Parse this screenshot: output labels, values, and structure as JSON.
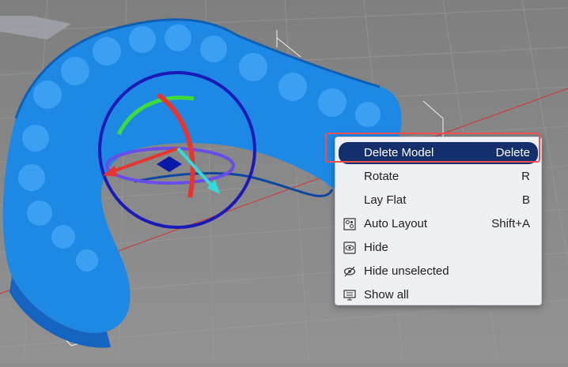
{
  "context_menu": {
    "items": [
      {
        "label": "Delete Model",
        "shortcut": "Delete",
        "icon": "",
        "highlighted": true
      },
      {
        "label": "Rotate",
        "shortcut": "R",
        "icon": ""
      },
      {
        "label": "Lay Flat",
        "shortcut": "B",
        "icon": ""
      },
      {
        "label": "Auto Layout",
        "shortcut": "Shift+A",
        "icon": "auto-layout-icon"
      },
      {
        "label": "Hide",
        "shortcut": "",
        "icon": "hide-icon"
      },
      {
        "label": "Hide unselected",
        "shortcut": "",
        "icon": "eye-slash-icon"
      },
      {
        "label": "Show all",
        "shortcut": "",
        "icon": "monitor-icon"
      }
    ]
  },
  "colors": {
    "model": "#1e88e5",
    "highlight": "#142f6b",
    "highlight_border": "#ef4f4f",
    "bed": "#8c8c8c"
  }
}
